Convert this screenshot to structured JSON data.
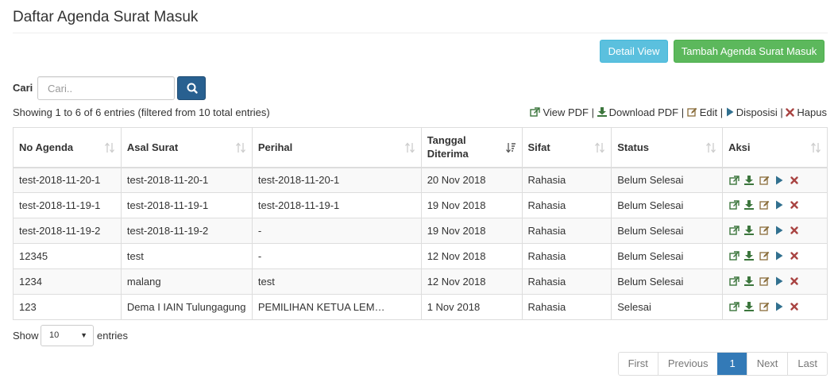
{
  "page": {
    "title": "Daftar Agenda Surat Masuk"
  },
  "actions": {
    "detail_view": "Detail View",
    "add": "Tambah Agenda Surat Masuk"
  },
  "search": {
    "label": "Cari",
    "placeholder": "Cari.."
  },
  "info": "Showing 1 to 6 of 6 entries (filtered from 10 total entries)",
  "legend": {
    "view_pdf": "View PDF",
    "download_pdf": "Download PDF",
    "edit": "Edit",
    "disposisi": "Disposisi",
    "hapus": "Hapus",
    "separator": "|"
  },
  "table": {
    "headers": [
      "No Agenda",
      "Asal Surat",
      "Perihal",
      "Tanggal Diterima",
      "Sifat",
      "Status",
      "Aksi"
    ],
    "header_tanggal_line1": "Tanggal",
    "header_tanggal_line2": "Diterima",
    "rows": [
      [
        "test-2018-11-20-1",
        "test-2018-11-20-1",
        "test-2018-11-20-1",
        "20 Nov 2018",
        "Rahasia",
        "Belum Selesai"
      ],
      [
        "test-2018-11-19-1",
        "test-2018-11-19-1",
        "test-2018-11-19-1",
        "19 Nov 2018",
        "Rahasia",
        "Belum Selesai"
      ],
      [
        "test-2018-11-19-2",
        "test-2018-11-19-2",
        "-",
        "19 Nov 2018",
        "Rahasia",
        "Belum Selesai"
      ],
      [
        "12345",
        "test",
        "-",
        "12 Nov 2018",
        "Rahasia",
        "Belum Selesai"
      ],
      [
        "1234",
        "malang",
        "test",
        "12 Nov 2018",
        "Rahasia",
        "Belum Selesai"
      ],
      [
        "123",
        "Dema I IAIN Tulungagung",
        "PEMILIHAN KETUA LEM…",
        "1 Nov 2018",
        "Rahasia",
        "Selesai"
      ]
    ]
  },
  "length": {
    "show": "Show",
    "value": "10",
    "entries": "entries"
  },
  "pagination": {
    "first": "First",
    "previous": "Previous",
    "current": "1",
    "next": "Next",
    "last": "Last"
  },
  "icons": {
    "view": "external-link-icon",
    "download": "download-icon",
    "edit": "edit-icon",
    "disposisi": "play-icon",
    "hapus": "remove-icon",
    "search": "search-icon",
    "sort": "sort-icon"
  },
  "colors": {
    "info": "#5bc0de",
    "success": "#5cb85c",
    "primary": "#286090",
    "active_page": "#337ab7",
    "green_icon": "#3c763d",
    "edit_icon": "#8a6d3b",
    "play_icon": "#31708f",
    "delete_icon": "#a94442"
  }
}
